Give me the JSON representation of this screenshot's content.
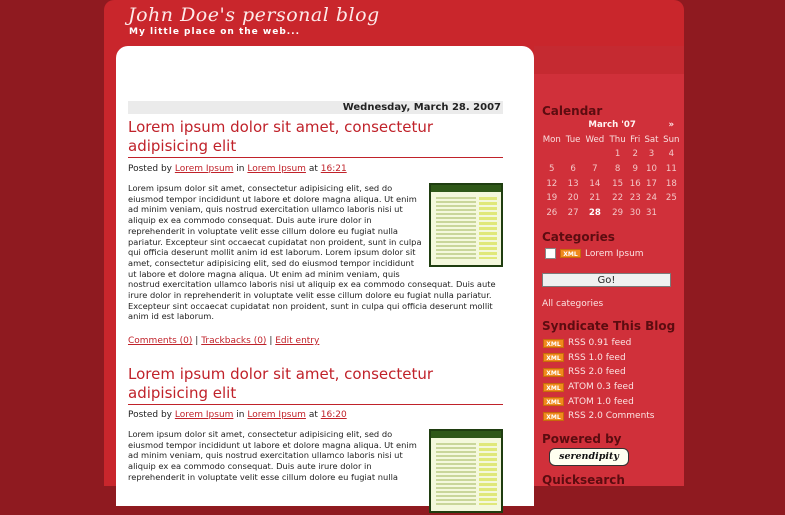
{
  "header": {
    "title": "John Doe's personal blog",
    "tagline": "My little place on the web..."
  },
  "date_header": "Wednesday, March 28. 2007",
  "posts": [
    {
      "title": "Lorem ipsum dolor sit amet, consectetur adipisicing elit",
      "byline_prefix": "Posted by",
      "author": "Lorem Ipsum",
      "in_label": "in",
      "category": "Lorem Ipsum",
      "at_label": "at",
      "time": "16:21",
      "body": "Lorem ipsum dolor sit amet, consectetur adipisicing elit, sed do eiusmod tempor incididunt ut labore et dolore magna aliqua. Ut enim ad minim veniam, quis nostrud exercitation ullamco laboris nisi ut aliquip ex ea commodo consequat. Duis aute irure dolor in reprehenderit in voluptate velit esse cillum dolore eu fugiat nulla pariatur. Excepteur sint occaecat cupidatat non proident, sunt in culpa qui officia deserunt mollit anim id est laborum. Lorem ipsum dolor sit amet, consectetur adipisicing elit, sed do eiusmod tempor incididunt ut labore et dolore magna aliqua. Ut enim ad minim veniam, quis nostrud exercitation ullamco laboris nisi ut aliquip ex ea commodo consequat. Duis aute irure dolor in reprehenderit in voluptate velit esse cillum dolore eu fugiat nulla pariatur. Excepteur sint occaecat cupidatat non proident, sunt in culpa qui officia deserunt mollit anim id est laborum.",
      "comments": "Comments (0)",
      "trackbacks": "Trackbacks (0)",
      "edit": "Edit entry",
      "separator": "|"
    },
    {
      "title": "Lorem ipsum dolor sit amet, consectetur adipisicing elit",
      "byline_prefix": "Posted by",
      "author": "Lorem Ipsum",
      "in_label": "in",
      "category": "Lorem Ipsum",
      "at_label": "at",
      "time": "16:20",
      "body": "Lorem ipsum dolor sit amet, consectetur adipisicing elit, sed do eiusmod tempor incididunt ut labore et dolore magna aliqua. Ut enim ad minim veniam, quis nostrud exercitation ullamco laboris nisi ut aliquip ex ea commodo consequat. Duis aute irure dolor in reprehenderit in voluptate velit esse cillum dolore eu fugiat nulla"
    }
  ],
  "sidebar": {
    "calendar": {
      "heading": "Calendar",
      "month": "March '07",
      "next": "»",
      "days": [
        "Mon",
        "Tue",
        "Wed",
        "Thu",
        "Fri",
        "Sat",
        "Sun"
      ],
      "weeks": [
        [
          "",
          "",
          "",
          "1",
          "2",
          "3",
          "4"
        ],
        [
          "5",
          "6",
          "7",
          "8",
          "9",
          "10",
          "11"
        ],
        [
          "12",
          "13",
          "14",
          "15",
          "16",
          "17",
          "18"
        ],
        [
          "19",
          "20",
          "21",
          "22",
          "23",
          "24",
          "25"
        ],
        [
          "26",
          "27",
          "28",
          "29",
          "30",
          "31",
          ""
        ]
      ],
      "today": "28"
    },
    "categories": {
      "heading": "Categories",
      "xml_label": "XML",
      "item": "Lorem Ipsum",
      "go_button": "Go!",
      "all": "All categories"
    },
    "syndicate": {
      "heading": "Syndicate This Blog",
      "xml_label": "XML",
      "feeds": [
        "RSS 0.91 feed",
        "RSS 1.0 feed",
        "RSS 2.0 feed",
        "ATOM 0.3 feed",
        "ATOM 1.0 feed",
        "RSS 2.0 Comments"
      ]
    },
    "powered": {
      "heading": "Powered by",
      "badge": "serendipity"
    },
    "quicksearch": {
      "heading": "Quicksearch"
    }
  },
  "colors": {
    "background": "#8f1a20",
    "accent": "#c0222a",
    "sidebar": "#d0303a"
  }
}
